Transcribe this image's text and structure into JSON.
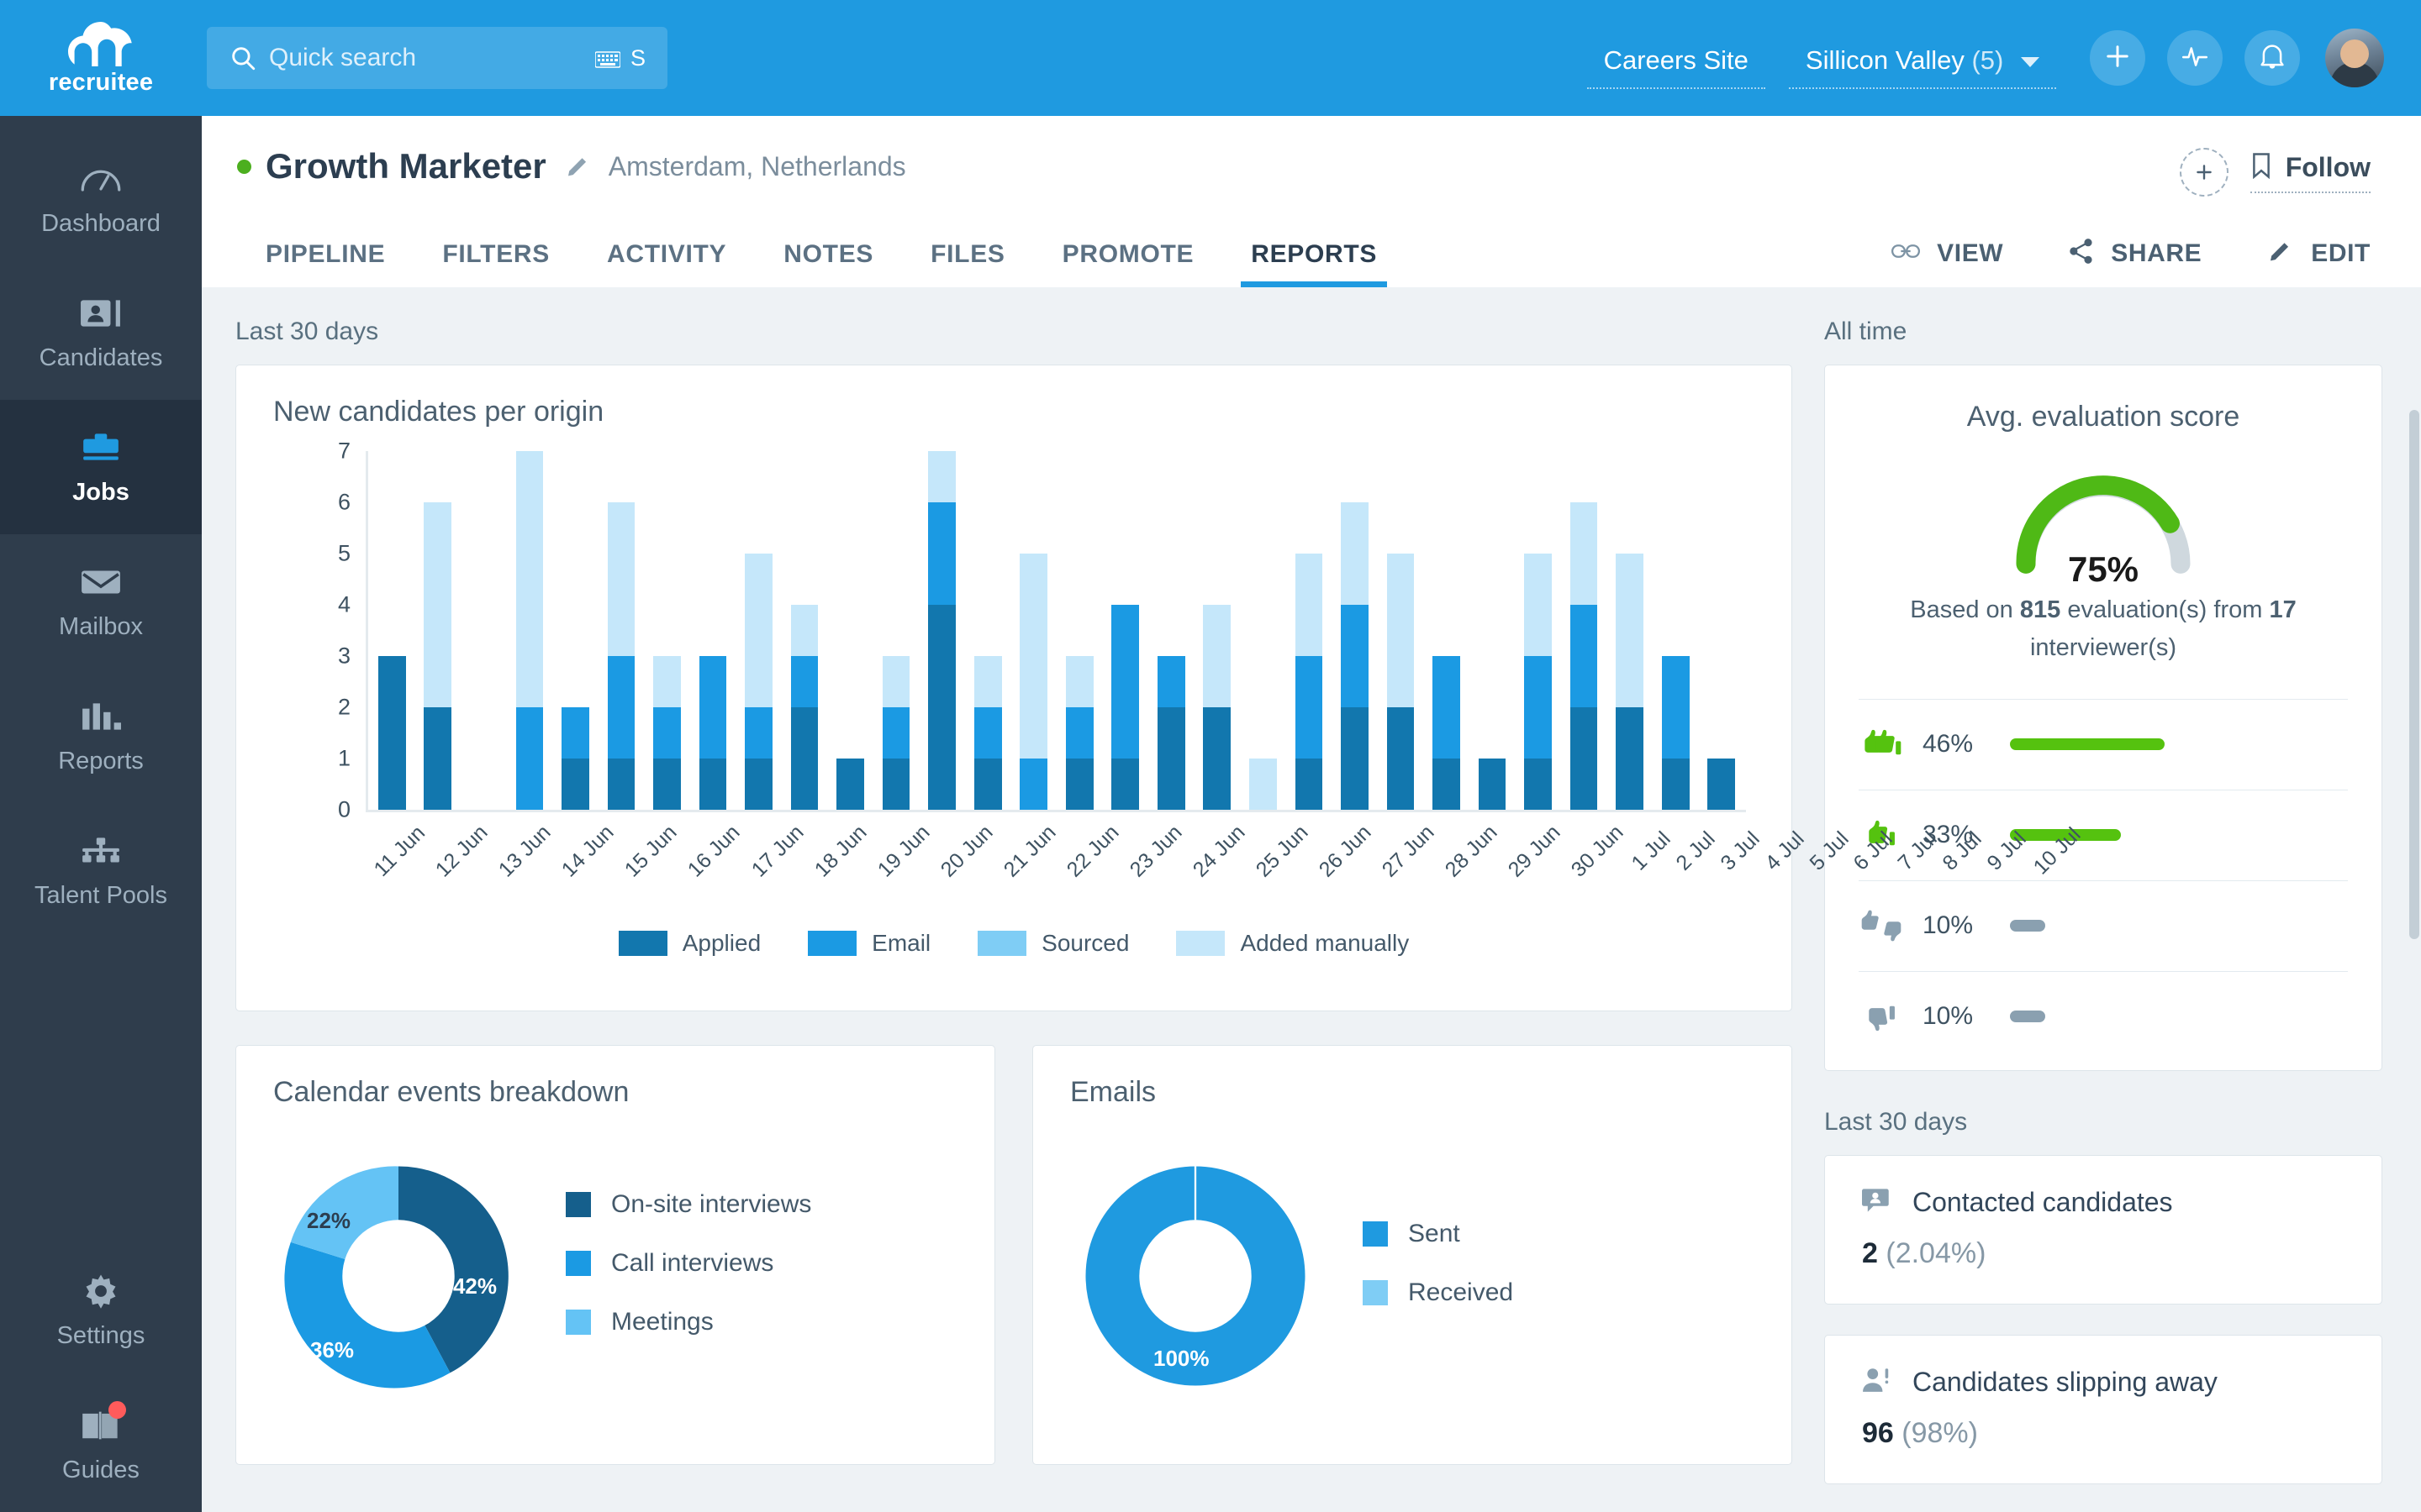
{
  "brand": {
    "name": "recruitee",
    "accent": "#1f9ae0"
  },
  "search": {
    "placeholder": "Quick search",
    "value": "",
    "shortcut": "S"
  },
  "topbar": {
    "careers_site": "Careers Site",
    "workspace": "Sillicon Valley",
    "workspace_count": "(5)",
    "icons": [
      "plus-icon",
      "activity-icon",
      "bell-icon",
      "avatar"
    ]
  },
  "sidebar": {
    "items": [
      {
        "label": "Dashboard",
        "icon": "gauge-icon",
        "active": false
      },
      {
        "label": "Candidates",
        "icon": "contact-card-icon",
        "active": false
      },
      {
        "label": "Jobs",
        "icon": "briefcase-icon",
        "active": true
      },
      {
        "label": "Mailbox",
        "icon": "envelope-icon",
        "active": false
      },
      {
        "label": "Reports",
        "icon": "bar-chart-icon",
        "active": false
      },
      {
        "label": "Talent Pools",
        "icon": "org-tree-icon",
        "active": false
      }
    ],
    "bottom_items": [
      {
        "label": "Settings",
        "icon": "gear-icon",
        "badge": false
      },
      {
        "label": "Guides",
        "icon": "book-icon",
        "badge": true
      }
    ]
  },
  "job": {
    "title": "Growth Marketer",
    "location": "Amsterdam, Netherlands",
    "status": "open",
    "follow_label": "Follow",
    "tabs": [
      {
        "label": "PIPELINE",
        "active": false
      },
      {
        "label": "FILTERS",
        "active": false
      },
      {
        "label": "ACTIVITY",
        "active": false
      },
      {
        "label": "NOTES",
        "active": false
      },
      {
        "label": "FILES",
        "active": false
      },
      {
        "label": "PROMOTE",
        "active": false
      },
      {
        "label": "REPORTS",
        "active": true
      }
    ],
    "actions": [
      {
        "label": "VIEW",
        "icon": "link-icon"
      },
      {
        "label": "SHARE",
        "icon": "share-icon"
      },
      {
        "label": "EDIT",
        "icon": "pencil-icon"
      }
    ]
  },
  "left_section_label": "Last 30 days",
  "right_section_label": "All time",
  "right_section_label_2": "Last 30 days",
  "evaluation": {
    "title": "Avg. evaluation score",
    "score": "75%",
    "score_value": 75,
    "based_on_prefix": "Based on",
    "evaluations": "815",
    "mid": "evaluation(s) from",
    "interviewers": "17",
    "suffix": "interviewer(s)",
    "ratings": [
      {
        "icon": "double-thumbs-up-icon",
        "pct": "46%",
        "value": 46,
        "color": "#55c20f"
      },
      {
        "icon": "thumbs-up-icon",
        "pct": "33%",
        "value": 33,
        "color": "#55c20f"
      },
      {
        "icon": "thumbs-up-down-icon",
        "pct": "10%",
        "value": 10,
        "color": "#8aa0b0"
      },
      {
        "icon": "thumbs-down-icon",
        "pct": "10%",
        "value": 10,
        "color": "#8aa0b0"
      }
    ]
  },
  "stats": [
    {
      "icon": "contacted-icon",
      "label": "Contacted candidates",
      "value": "2",
      "pct": "(2.04%)"
    },
    {
      "icon": "slipping-icon",
      "label": "Candidates slipping away",
      "value": "96",
      "pct": "(98%)"
    }
  ],
  "chart_data": [
    {
      "type": "bar",
      "id": "new-candidates-per-origin",
      "title": "New candidates per origin",
      "stacked": true,
      "xlabel": "",
      "ylabel": "",
      "ylim": [
        0,
        7
      ],
      "yticks": [
        0,
        1,
        2,
        3,
        4,
        5,
        6,
        7
      ],
      "grid": false,
      "legend_position": "bottom",
      "categories": [
        "11 Jun",
        "12 Jun",
        "13 Jun",
        "14 Jun",
        "15 Jun",
        "16 Jun",
        "17 Jun",
        "18 Jun",
        "19 Jun",
        "20 Jun",
        "21 Jun",
        "22 Jun",
        "23 Jun",
        "24 Jun",
        "25 Jun",
        "26 Jun",
        "27 Jun",
        "28 Jun",
        "29 Jun",
        "30 Jun",
        "1 Jul",
        "2 Jul",
        "3 Jul",
        "4 Jul",
        "5 Jul",
        "6 Jul",
        "7 Jul",
        "8 Jul",
        "9 Jul",
        "10 Jul"
      ],
      "series": [
        {
          "name": "Applied",
          "color": "#1277ae",
          "values": [
            3,
            2,
            0,
            0,
            1,
            1,
            1,
            1,
            1,
            2,
            1,
            1,
            4,
            1,
            0,
            1,
            1,
            2,
            2,
            0,
            1,
            2,
            2,
            1,
            1,
            1,
            2,
            2,
            1,
            1
          ]
        },
        {
          "name": "Email",
          "color": "#1b9ae3",
          "values": [
            0,
            0,
            0,
            2,
            1,
            2,
            1,
            2,
            1,
            1,
            0,
            1,
            2,
            1,
            1,
            1,
            3,
            1,
            0,
            0,
            2,
            2,
            0,
            2,
            0,
            2,
            2,
            0,
            2,
            0
          ]
        },
        {
          "name": "Sourced",
          "color": "#7fcdf5",
          "values": [
            0,
            0,
            0,
            0,
            0,
            0,
            0,
            0,
            0,
            0,
            0,
            0,
            0,
            0,
            0,
            0,
            0,
            0,
            0,
            0,
            0,
            0,
            0,
            0,
            0,
            0,
            0,
            0,
            0,
            0
          ]
        },
        {
          "name": "Added manually",
          "color": "#c5e7fa",
          "values": [
            0,
            4,
            0,
            5,
            0,
            3,
            1,
            0,
            3,
            1,
            0,
            1,
            1,
            1,
            4,
            1,
            0,
            0,
            2,
            1,
            2,
            2,
            3,
            0,
            0,
            2,
            2,
            3,
            0,
            0
          ]
        }
      ],
      "totals": [
        3,
        6,
        0,
        7,
        2,
        6,
        3,
        3,
        5,
        4,
        1,
        3,
        7,
        3,
        5,
        3,
        4,
        3,
        4,
        1,
        5,
        6,
        5,
        3,
        1,
        5,
        6,
        5,
        3,
        1
      ]
    },
    {
      "type": "pie",
      "id": "calendar-events-breakdown",
      "title": "Calendar events breakdown",
      "donut": true,
      "legend_position": "right",
      "labels": [
        "On-site interviews",
        "Call interviews",
        "Meetings"
      ],
      "values": [
        42,
        36,
        22
      ],
      "value_labels": [
        "42%",
        "36%",
        "22%"
      ],
      "colors": [
        "#155f8c",
        "#1b9ae3",
        "#64c3f5"
      ]
    },
    {
      "type": "pie",
      "id": "emails",
      "title": "Emails",
      "donut": true,
      "legend_position": "right",
      "labels": [
        "Sent",
        "Received"
      ],
      "values": [
        100,
        0
      ],
      "value_labels": [
        "100%"
      ],
      "colors": [
        "#1f9ae0",
        "#7fcdf5"
      ]
    }
  ]
}
